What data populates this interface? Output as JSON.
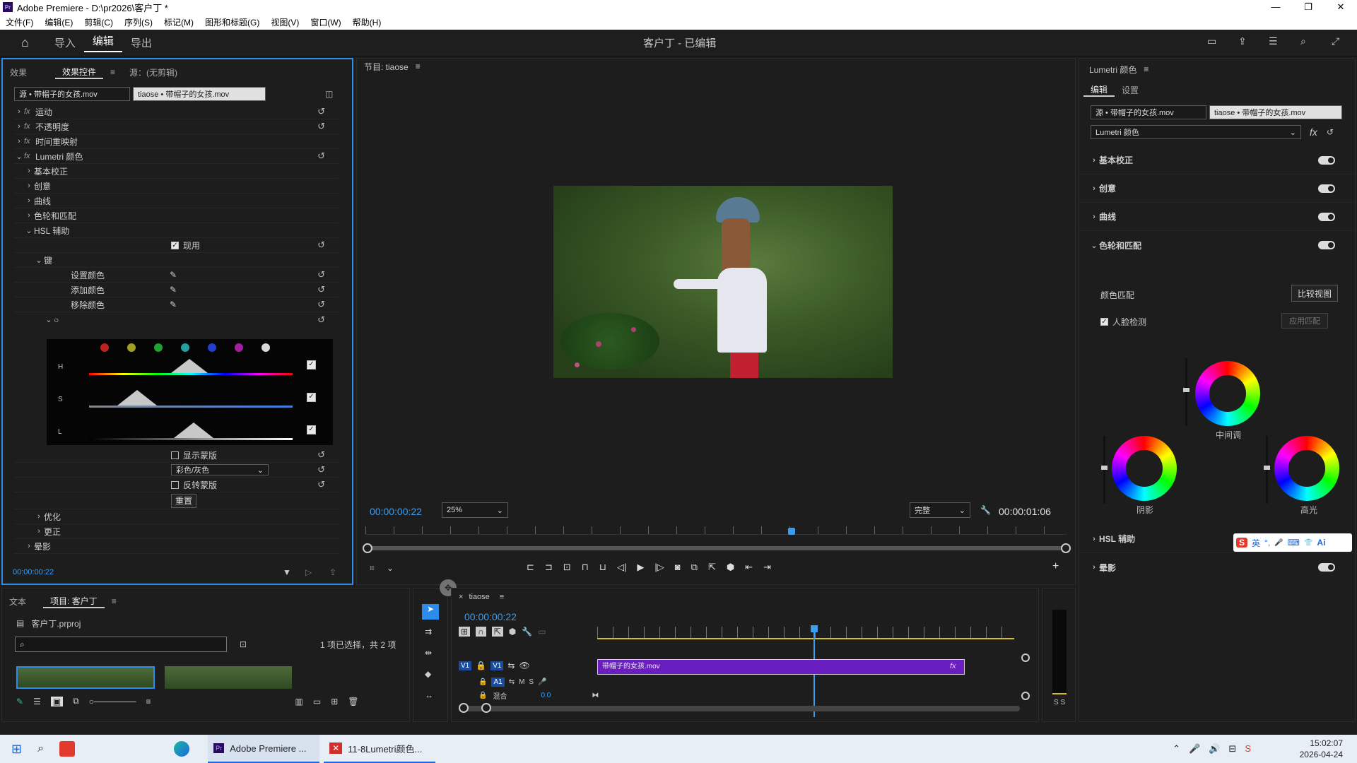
{
  "window": {
    "title": "Adobe Premiere - D:\\pr2026\\客户丁 *",
    "app_icon": "Pr",
    "controls": [
      "—",
      "❐",
      "✕"
    ]
  },
  "menu": [
    "文件(F)",
    "编辑(E)",
    "剪辑(C)",
    "序列(S)",
    "标记(M)",
    "图形和标题(G)",
    "视图(V)",
    "窗口(W)",
    "帮助(H)"
  ],
  "header": {
    "tabs": [
      "导入",
      "编辑",
      "导出"
    ],
    "active_tab": "编辑",
    "project_title": "客户丁 - 已编辑"
  },
  "effect_controls": {
    "tabs": [
      "效果",
      "效果控件",
      "源：(无剪辑)"
    ],
    "active_tab": "效果控件",
    "source_clip": "源 • 带帽子的女孩.mov",
    "seq_clip": "tiaose • 带帽子的女孩.mov",
    "effects": [
      "运动",
      "不透明度",
      "时间重映射",
      "Lumetri 颜色"
    ],
    "lumetri_sections": [
      "基本校正",
      "创意",
      "曲线",
      "色轮和匹配",
      "HSL 辅助"
    ],
    "apply_label": "现用",
    "key_label": "键",
    "key_rows": [
      "设置颜色",
      "添加颜色",
      "移除颜色"
    ],
    "hsl_channels": [
      "H",
      "S",
      "L"
    ],
    "show_mask": "显示蒙版",
    "mask_mode": "彩色/灰色",
    "invert_mask": "反转蒙版",
    "reset": "重置",
    "more_sections": [
      "优化",
      "更正",
      "晕影"
    ],
    "timecode": "00:00:00:22"
  },
  "program_monitor": {
    "title": "节目: tiaose",
    "timecode": "00:00:00:22",
    "zoom": "25%",
    "quality": "完整",
    "duration": "00:00:01:06"
  },
  "lumetri": {
    "title": "Lumetri 颜色",
    "tabs": [
      "编辑",
      "设置"
    ],
    "active_tab": "编辑",
    "source_clip": "源 • 带帽子的女孩.mov",
    "seq_clip": "tiaose • 带帽子的女孩.mov",
    "effect_select": "Lumetri 颜色",
    "sections": [
      "基本校正",
      "创意",
      "曲线",
      "色轮和匹配"
    ],
    "color_match": "颜色匹配",
    "compare_view": "比较视图",
    "face_detect": "人脸检测",
    "apply_match": "应用匹配",
    "wheels": [
      "中间调",
      "阴影",
      "高光"
    ],
    "bottom_sections": [
      "HSL 辅助",
      "晕影"
    ]
  },
  "project": {
    "tabs": [
      "文本",
      "项目: 客户丁"
    ],
    "active_tab": "项目: 客户丁",
    "file": "客户丁.prproj",
    "search_placeholder": "",
    "selection_info": "1 项已选择，共 2 项"
  },
  "timeline": {
    "tab": "tiaose",
    "timecode": "00:00:00:22",
    "tracks": {
      "v1": "V1",
      "a1": "A1",
      "mix": "混合",
      "mix_value": "0.0"
    },
    "clip_name": "带帽子的女孩.mov"
  },
  "audio_meter": {
    "labels": "S S"
  },
  "ime": {
    "items": [
      "S",
      "英",
      "°,",
      "🎤",
      "⌨",
      "👕",
      "Ai"
    ]
  },
  "taskbar": {
    "apps": [
      "Adobe Premiere ...",
      "11-8Lumetri颜色..."
    ],
    "time": "15:02:07",
    "date": "2026-04-24"
  }
}
